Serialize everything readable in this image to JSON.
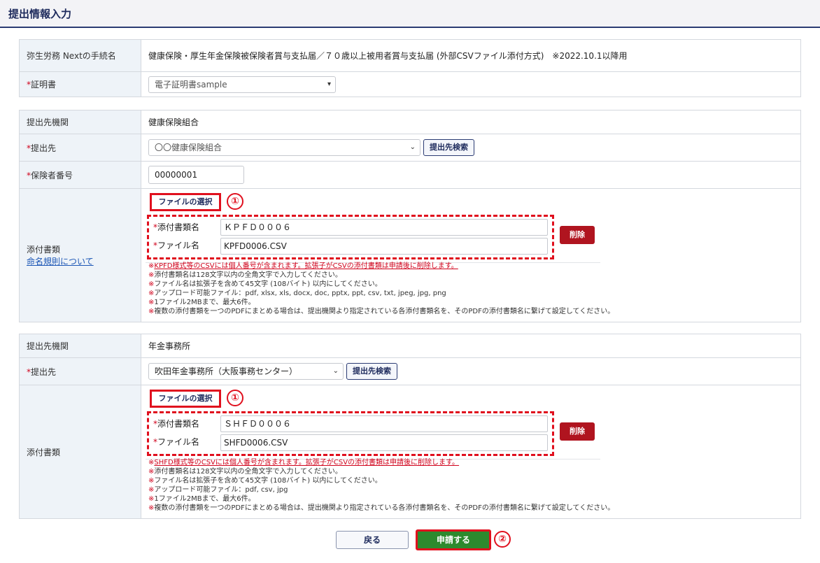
{
  "page": {
    "title": "提出情報入力"
  },
  "section1": {
    "procedure_label": "弥生労務 Nextの手続名",
    "procedure_value": "健康保険・厚生年金保険被保険者賞与支払届／７０歳以上被用者賞与支払届 (外部CSVファイル添付方式)　※2022.10.1以降用",
    "cert_label": "証明書",
    "cert_value": "電子証明書sample"
  },
  "section2": {
    "org_label": "提出先機関",
    "org_value": "健康保険組合",
    "dest_label": "提出先",
    "dest_value": "〇〇健康保険組合",
    "search_button": "提出先検索",
    "insurer_label": "保険者番号",
    "insurer_value": "00000001",
    "attach_label": "添付書類",
    "naming_link": "命名規則について",
    "file_select_button": "ファイルの選択",
    "marker": "①",
    "doc_name_label": "添付書類名",
    "doc_name_value": "ＫＰＦＤ０００６",
    "file_name_label": "ファイル名",
    "file_name_value": "KPFD0006.CSV",
    "delete_button": "削除",
    "notes_mark": "※",
    "notes": [
      "KPFD様式等のCSVには個人番号が含まれます。拡張子がCSVの添付書類は申請後に削除します。",
      "添付書類名は128文字以内の全角文字で入力してください。",
      "ファイル名は拡張子を含めて45文字 (108バイト) 以内にしてください。",
      "アップロード可能ファイル：pdf, xlsx, xls, docx, doc, pptx, ppt, csv, txt, jpeg, jpg, png",
      "1ファイル2MBまで、最大6件。",
      "複数の添付書類を一つのPDFにまとめる場合は、提出機関より指定されている各添付書類名を、そのPDFの添付書類名に繋げて設定してください。"
    ]
  },
  "section3": {
    "org_label": "提出先機関",
    "org_value": "年金事務所",
    "dest_label": "提出先",
    "dest_value": "吹田年金事務所（大阪事務センター）",
    "search_button": "提出先検索",
    "attach_label": "添付書類",
    "file_select_button": "ファイルの選択",
    "marker": "①",
    "doc_name_label": "添付書類名",
    "doc_name_value": "ＳＨＦＤ０００６",
    "file_name_label": "ファイル名",
    "file_name_value": "SHFD0006.CSV",
    "delete_button": "削除",
    "notes_mark": "※",
    "notes": [
      "SHFD様式等のCSVには個人番号が含まれます。拡張子がCSVの添付書類は申請後に削除します。",
      "添付書類名は128文字以内の全角文字で入力してください。",
      "ファイル名は拡張子を含めて45文字 (108バイト) 以内にしてください。",
      "アップロード可能ファイル：pdf, csv, jpg",
      "1ファイル2MBまで、最大6件。",
      "複数の添付書類を一つのPDFにまとめる場合は、提出機関より指定されている各添付書類名を、そのPDFの添付書類名に繋げて設定してください。"
    ]
  },
  "footer": {
    "back_button": "戻る",
    "apply_button": "申請する",
    "marker": "②"
  },
  "colors": {
    "header_text": "#1d2a5c",
    "annotation_red": "#e0101e",
    "apply_green": "#2d8a2e",
    "delete_red": "#b0141f"
  }
}
